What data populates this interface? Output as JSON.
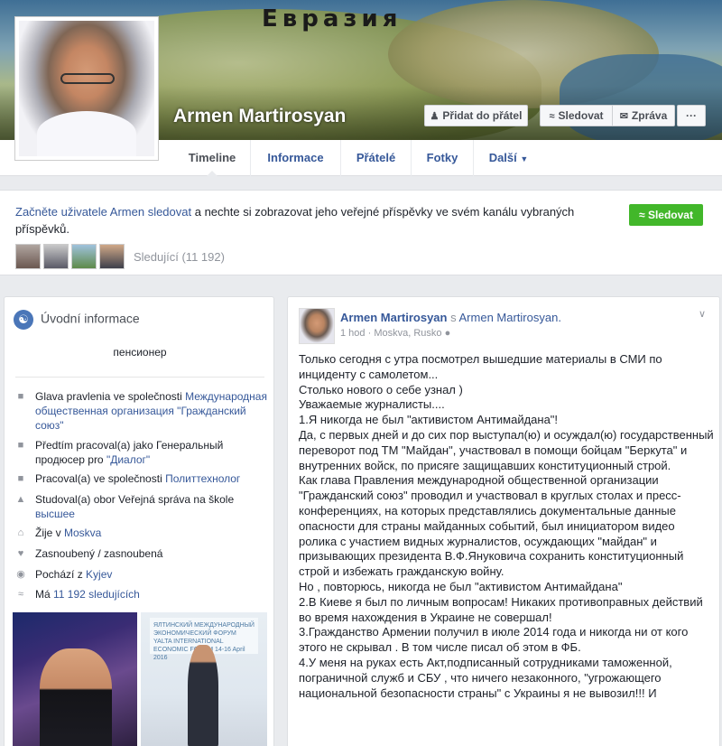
{
  "cover": {
    "title": "Евразия"
  },
  "profile": {
    "name": "Armen Martirosyan"
  },
  "header_buttons": {
    "add_friend": "Přidat do přátel",
    "follow": "Sledovat",
    "message": "Zpráva",
    "more": "···"
  },
  "tabs": [
    "Timeline",
    "Informace",
    "Přátelé",
    "Fotky",
    "Další"
  ],
  "follow_box": {
    "prefix": "Začněte uživatele Armen sledovat",
    "rest": " a nechte si zobrazovat jeho veřejné příspěvky ve svém kanálu vybraných příspěvků.",
    "button": "Sledovat",
    "followers": "Sledující (11 192)"
  },
  "intro": {
    "title": "Úvodní informace",
    "status": "пенсионер",
    "items": [
      {
        "icon": "briefcase-icon",
        "text": "Glava pravlenia ve společnosti ",
        "link": "Международная общественная организация \"Гражданский союз\""
      },
      {
        "icon": "briefcase-icon",
        "text": "Předtím pracoval(a) jako Генеральный продюсер pro ",
        "link": "\"Диалог\""
      },
      {
        "icon": "briefcase-icon",
        "text": "Pracoval(a) ve společnosti ",
        "link": "Политтехнолог"
      },
      {
        "icon": "graduation-cap-icon",
        "text": "Studoval(a) obor Veřejná správa na škole ",
        "link": "высшее"
      },
      {
        "icon": "home-icon",
        "text": "Žije v ",
        "link": "Moskva"
      },
      {
        "icon": "heart-icon",
        "text": "Zasnoubený / zasnoubená",
        "link": ""
      },
      {
        "icon": "location-pin-icon",
        "text": "Pochází z ",
        "link": "Kyjev"
      },
      {
        "icon": "rss-icon",
        "text": "Má ",
        "link": "11 192 sledujících"
      }
    ],
    "photo_banner": "ЯЛТИНСКИЙ МЕЖДУНАРОДНЫЙ ЭКОНОМИЧЕСКИЙ ФОРУМ  YALTA INTERNATIONAL ECONOMIC FORUM 14-16 April 2016"
  },
  "post": {
    "author": "Armen Martirosyan",
    "with_word": "s",
    "with_name": "Armen Martirosyan.",
    "time": "1 hod",
    "location": "Moskva, Rusko",
    "lines": [
      "Только сегодня с утра посмотрел вышедшие материалы в СМИ по инциденту с самолетом...",
      "Столько нового о себе узнал )",
      "Уважаемые журналисты....",
      "1.Я никогда не был \"активистом Антимайдана\"!",
      "Да, с первых дней и до сих пор выступал(ю) и осуждал(ю) государственный переворот под ТМ \"Майдан\", участвовал в помощи бойцам \"Беркута\" и внутренних войск, по присяге защищавших конституционный строй.",
      "Как глава Правления международной общественной организации \"Гражданский союз\" проводил и участвовал в круглых столах и пресс-конференциях, на которых представлялись документальные данные опасности для страны майданных событий, был инициатором видео ролика с участием видных журналистов, осуждающих \"майдан\" и призывающих президента В.Ф.Януковича сохранить конституционный строй и избежать гражданскую войну.",
      "Но , повторюсь, никогда не был \"активистом Антимайдана\"",
      "2.В Киеве я был по личным вопросам! Никаких противоправных действий во время нахождения в Украине не совершал!",
      "3.Гражданство Армении получил в июле 2014 года и никогда ни от кого этого не скрывал . В том числе писал об этом в ФБ.",
      "4.У меня на руках есть Акт,подписанный сотрудниками таможенной, пограничной служб и СБУ , что ничего незаконного, \"угрожающего национальной безопасности страны\" с Украины я не вывозил!!! И"
    ]
  }
}
